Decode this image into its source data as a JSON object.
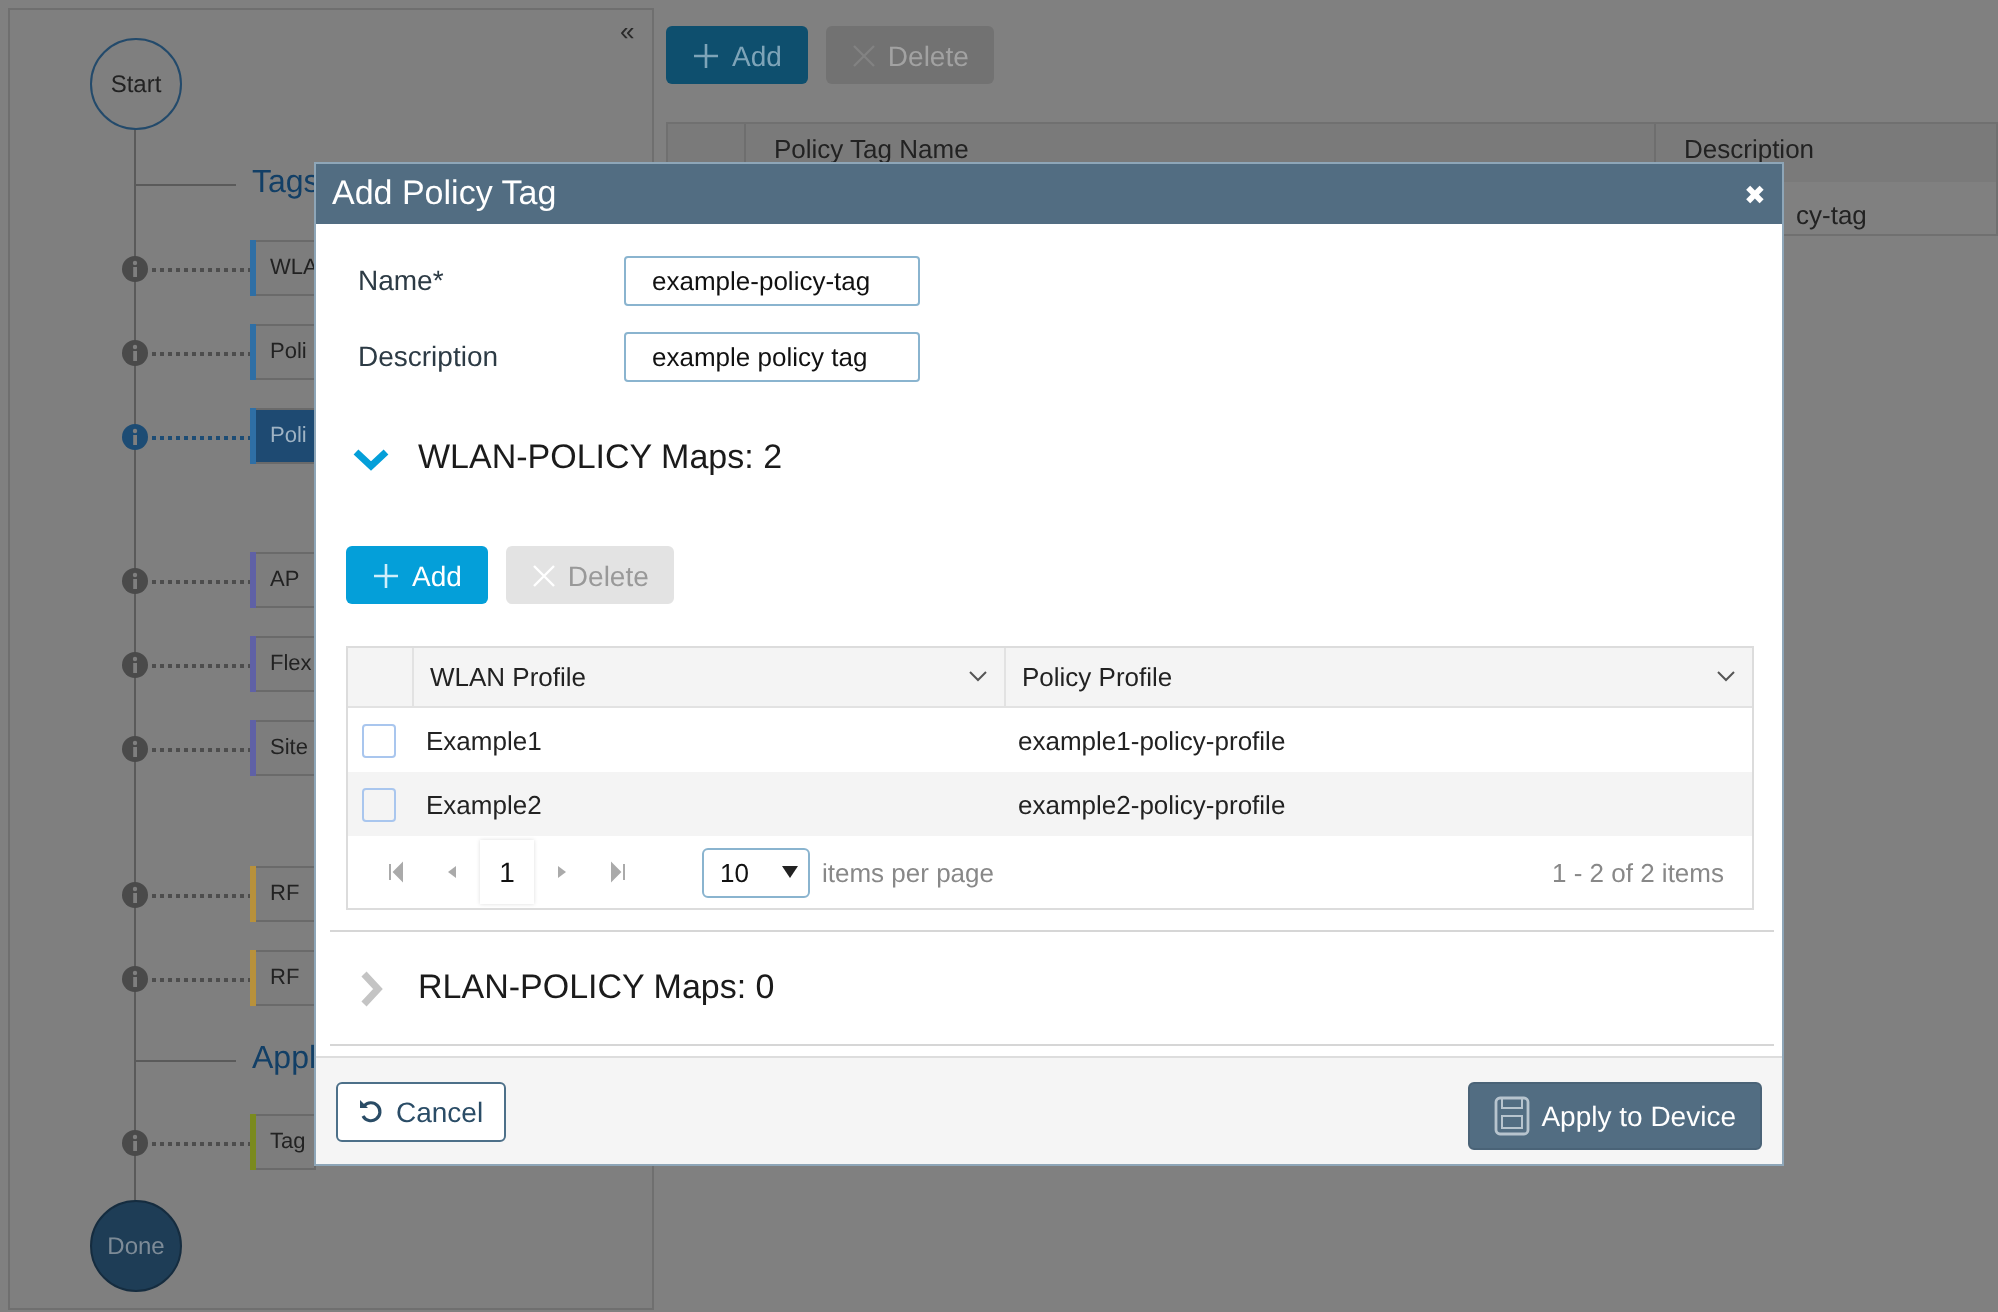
{
  "sidebar": {
    "collapse": "«",
    "timeline": [
      {
        "kind": "node",
        "label": "Start",
        "filled": false
      },
      {
        "kind": "section",
        "label": "Tags"
      },
      {
        "kind": "step",
        "label": "WLA",
        "color": "#2f6fa5",
        "selected": false
      },
      {
        "kind": "step",
        "label": "Poli",
        "color": "#2f6fa5",
        "selected": false
      },
      {
        "kind": "step",
        "label": "Poli",
        "color": "#2f6fa5",
        "selected": true
      },
      {
        "kind": "step",
        "label": "AP",
        "color": "#5f61a6",
        "selected": false
      },
      {
        "kind": "step",
        "label": "Flex",
        "color": "#5f61a6",
        "selected": false
      },
      {
        "kind": "step",
        "label": "Site",
        "color": "#5f61a6",
        "selected": false
      },
      {
        "kind": "step",
        "label": "RF",
        "color": "#b8913b",
        "selected": false
      },
      {
        "kind": "step",
        "label": "RF",
        "color": "#b8913b",
        "selected": false
      },
      {
        "kind": "section",
        "label": "Appl"
      },
      {
        "kind": "step",
        "label": "Tag",
        "color": "#7a8a1e",
        "selected": false
      },
      {
        "kind": "node",
        "label": "Done",
        "filled": true
      }
    ]
  },
  "page": {
    "buttons": [
      {
        "kind": "add",
        "label": "Add",
        "disabled": false
      },
      {
        "kind": "delete",
        "label": "Delete",
        "disabled": true
      }
    ],
    "table": {
      "columns": [
        "Policy Tag Name",
        "Description"
      ],
      "rows": [
        {
          "description": "cy-tag"
        }
      ]
    }
  },
  "dialog": {
    "title": "Add Policy Tag",
    "close": "✖",
    "fields": [
      {
        "label": "Name*",
        "value": "example-policy-tag"
      },
      {
        "label": "Description",
        "value": "example policy tag"
      }
    ],
    "sections": [
      {
        "title": "WLAN-POLICY Maps: 2",
        "expanded": true,
        "buttons": [
          {
            "kind": "add",
            "label": "Add",
            "disabled": false
          },
          {
            "kind": "delete",
            "label": "Delete",
            "disabled": true
          }
        ],
        "columns": [
          "WLAN Profile",
          "Policy Profile"
        ],
        "rows": [
          {
            "checked": false,
            "wlan": "Example1",
            "policy": "example1-policy-profile"
          },
          {
            "checked": false,
            "wlan": "Example2",
            "policy": "example2-policy-profile"
          }
        ],
        "pager": {
          "page": "1",
          "page_size": "10",
          "per_page_label": "items per page",
          "summary": "1 - 2 of 2 items"
        }
      },
      {
        "title": "RLAN-POLICY Maps: 0",
        "expanded": false
      }
    ],
    "buttons": [
      {
        "kind": "cancel",
        "label": "Cancel"
      },
      {
        "kind": "apply",
        "label": "Apply to Device"
      }
    ]
  }
}
